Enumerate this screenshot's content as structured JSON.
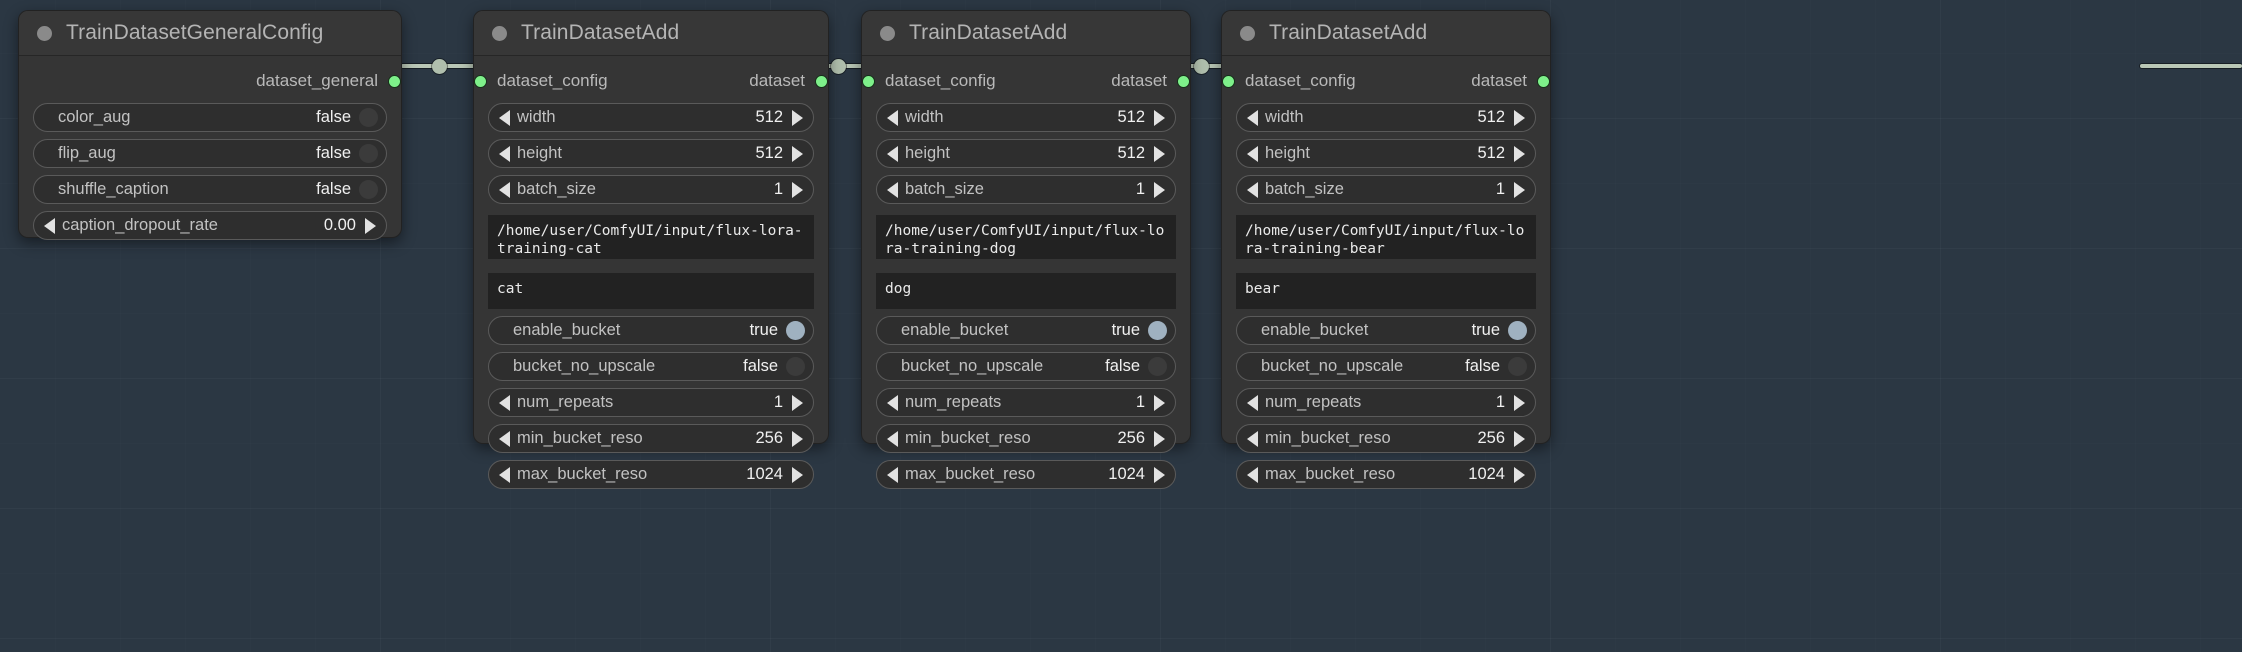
{
  "canvas": {
    "background_color": "#2b3743",
    "node_color": "#353535",
    "node_header_color": "#373737",
    "slot_dot_color": "#7ef08a",
    "link_color": "#b9c7b6",
    "toggle_on_color": "#9fb1c0",
    "toggle_off_color": "#3b3b3b"
  },
  "nodes": [
    {
      "title": "TrainDatasetGeneralConfig",
      "outputs": [
        {
          "label": "dataset_general"
        }
      ],
      "inputs": [],
      "widgets": [
        {
          "type": "toggle",
          "label": "color_aug",
          "value": "false",
          "state": "off"
        },
        {
          "type": "toggle",
          "label": "flip_aug",
          "value": "false",
          "state": "off"
        },
        {
          "type": "toggle",
          "label": "shuffle_caption",
          "value": "false",
          "state": "off"
        },
        {
          "type": "number",
          "label": "caption_dropout_rate",
          "value": "0.00"
        }
      ]
    },
    {
      "title": "TrainDatasetAdd",
      "inputs": [
        {
          "label": "dataset_config"
        }
      ],
      "outputs": [
        {
          "label": "dataset"
        }
      ],
      "widgets": [
        {
          "type": "number",
          "label": "width",
          "value": "512"
        },
        {
          "type": "number",
          "label": "height",
          "value": "512"
        },
        {
          "type": "number",
          "label": "batch_size",
          "value": "1"
        }
      ],
      "path_text": "/home/user/ComfyUI/input/flux-lora-training-cat",
      "caption_text": "cat",
      "widgets2": [
        {
          "type": "toggle",
          "label": "enable_bucket",
          "value": "true",
          "state": "on"
        },
        {
          "type": "toggle",
          "label": "bucket_no_upscale",
          "value": "false",
          "state": "off"
        },
        {
          "type": "number",
          "label": "num_repeats",
          "value": "1"
        },
        {
          "type": "number",
          "label": "min_bucket_reso",
          "value": "256"
        },
        {
          "type": "number",
          "label": "max_bucket_reso",
          "value": "1024"
        }
      ]
    },
    {
      "title": "TrainDatasetAdd",
      "inputs": [
        {
          "label": "dataset_config"
        }
      ],
      "outputs": [
        {
          "label": "dataset"
        }
      ],
      "widgets": [
        {
          "type": "number",
          "label": "width",
          "value": "512"
        },
        {
          "type": "number",
          "label": "height",
          "value": "512"
        },
        {
          "type": "number",
          "label": "batch_size",
          "value": "1"
        }
      ],
      "path_text": "/home/user/ComfyUI/input/flux-lora-training-dog",
      "caption_text": "dog",
      "widgets2": [
        {
          "type": "toggle",
          "label": "enable_bucket",
          "value": "true",
          "state": "on"
        },
        {
          "type": "toggle",
          "label": "bucket_no_upscale",
          "value": "false",
          "state": "off"
        },
        {
          "type": "number",
          "label": "num_repeats",
          "value": "1"
        },
        {
          "type": "number",
          "label": "min_bucket_reso",
          "value": "256"
        },
        {
          "type": "number",
          "label": "max_bucket_reso",
          "value": "1024"
        }
      ]
    },
    {
      "title": "TrainDatasetAdd",
      "inputs": [
        {
          "label": "dataset_config"
        }
      ],
      "outputs": [
        {
          "label": "dataset"
        }
      ],
      "widgets": [
        {
          "type": "number",
          "label": "width",
          "value": "512"
        },
        {
          "type": "number",
          "label": "height",
          "value": "512"
        },
        {
          "type": "number",
          "label": "batch_size",
          "value": "1"
        }
      ],
      "path_text": "/home/user/ComfyUI/input/flux-lora-training-bear",
      "caption_text": "bear",
      "widgets2": [
        {
          "type": "toggle",
          "label": "enable_bucket",
          "value": "true",
          "state": "on"
        },
        {
          "type": "toggle",
          "label": "bucket_no_upscale",
          "value": "false",
          "state": "off"
        },
        {
          "type": "number",
          "label": "num_repeats",
          "value": "1"
        },
        {
          "type": "number",
          "label": "min_bucket_reso",
          "value": "256"
        },
        {
          "type": "number",
          "label": "max_bucket_reso",
          "value": "1024"
        }
      ]
    }
  ]
}
